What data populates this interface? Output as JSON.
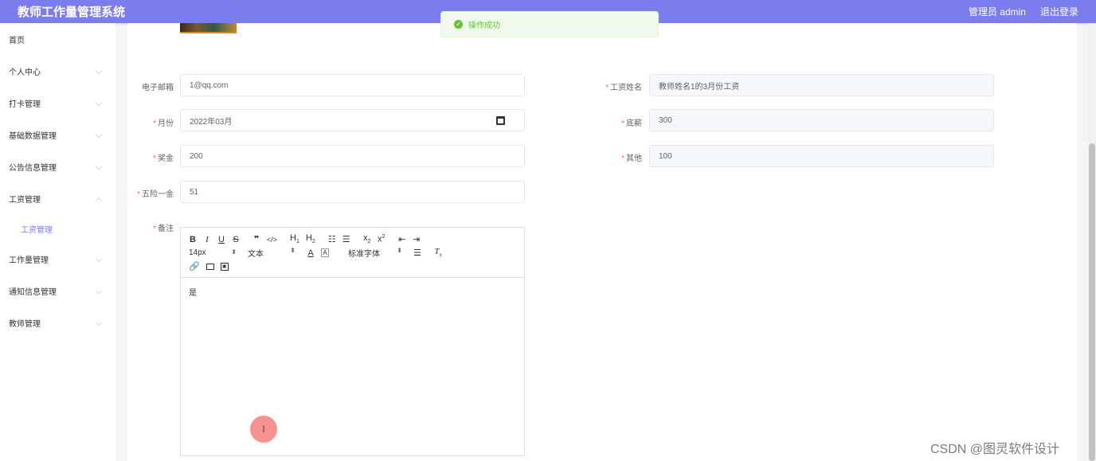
{
  "header": {
    "title": "教师工作量管理系统",
    "user": "管理员 admin",
    "logout": "退出登录"
  },
  "sidebar": {
    "items": [
      {
        "label": "首页"
      },
      {
        "label": "个人中心"
      },
      {
        "label": "打卡管理"
      },
      {
        "label": "基础数据管理"
      },
      {
        "label": "公告信息管理"
      },
      {
        "label": "工资管理"
      },
      {
        "label": "工作量管理"
      },
      {
        "label": "通知信息管理"
      },
      {
        "label": "教师管理"
      }
    ],
    "sub": "工资管理"
  },
  "toast": {
    "text": "操作成功",
    "color": "#67c23a"
  },
  "form": {
    "email": {
      "label": "电子邮箱",
      "value": "1@qq.com"
    },
    "salary_name": {
      "label": "工资姓名",
      "value": "教师姓名1的3月份工资"
    },
    "month": {
      "label": "月份",
      "value": "2022年03月"
    },
    "base": {
      "label": "底薪",
      "value": "300"
    },
    "bonus": {
      "label": "奖金",
      "value": "200"
    },
    "other": {
      "label": "其他",
      "value": "100"
    },
    "insurance": {
      "label": "五险一金",
      "value": "51"
    },
    "remark": {
      "label": "备注",
      "value": "是"
    }
  },
  "editor": {
    "font_size": "14px",
    "text_type": "文本",
    "font_family": "标准字体"
  },
  "watermark": "CSDN @图灵软件设计",
  "colors": {
    "header": "#7b7dee",
    "required": "#f56c6c",
    "accent": "#7b7dee"
  }
}
